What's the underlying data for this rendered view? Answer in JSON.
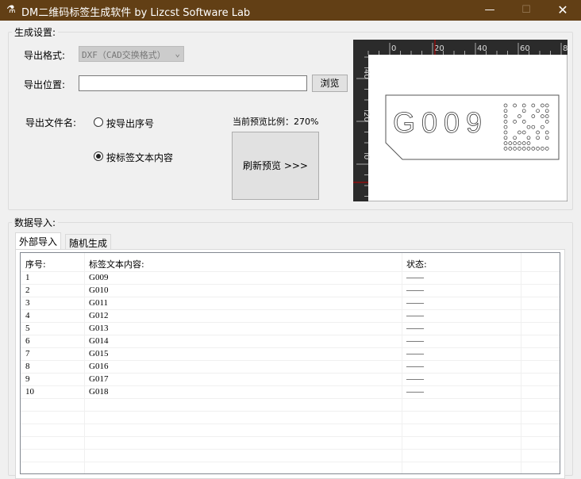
{
  "window": {
    "title": "DM二维码标签生成软件  by Lizcst Software Lab"
  },
  "settings": {
    "group_label": "生成设置:",
    "format_label": "导出格式:",
    "format_value": "DXF（CAD交换格式）",
    "location_label": "导出位置:",
    "location_value": "",
    "browse_label": "浏览",
    "filename_label": "导出文件名:",
    "radio_serial": "按导出序号",
    "radio_content": "按标签文本内容",
    "radio_selected": "content",
    "scale_text": "当前预览比例：270%",
    "refresh_label": "刷新预览 >>>"
  },
  "preview": {
    "label_text": "G009",
    "x_ticks": [
      "0",
      "20",
      "40",
      "60",
      "80"
    ],
    "y_ticks": [
      "40",
      "20",
      "0"
    ],
    "ruler_color": "#2b2b2b",
    "marker_color": "#c00000"
  },
  "data_import": {
    "group_label": "数据导入:",
    "tabs": [
      "外部导入",
      "随机生成"
    ],
    "active_tab": 0,
    "columns": [
      "序号:",
      "标签文本内容:",
      "状态:"
    ],
    "rows": [
      [
        "1",
        "G009",
        "——"
      ],
      [
        "2",
        "G010",
        "——"
      ],
      [
        "3",
        "G011",
        "——"
      ],
      [
        "4",
        "G012",
        "——"
      ],
      [
        "5",
        "G013",
        "——"
      ],
      [
        "6",
        "G014",
        "——"
      ],
      [
        "7",
        "G015",
        "——"
      ],
      [
        "8",
        "G016",
        "——"
      ],
      [
        "9",
        "G017",
        "——"
      ],
      [
        "10",
        "G018",
        "——"
      ]
    ]
  }
}
